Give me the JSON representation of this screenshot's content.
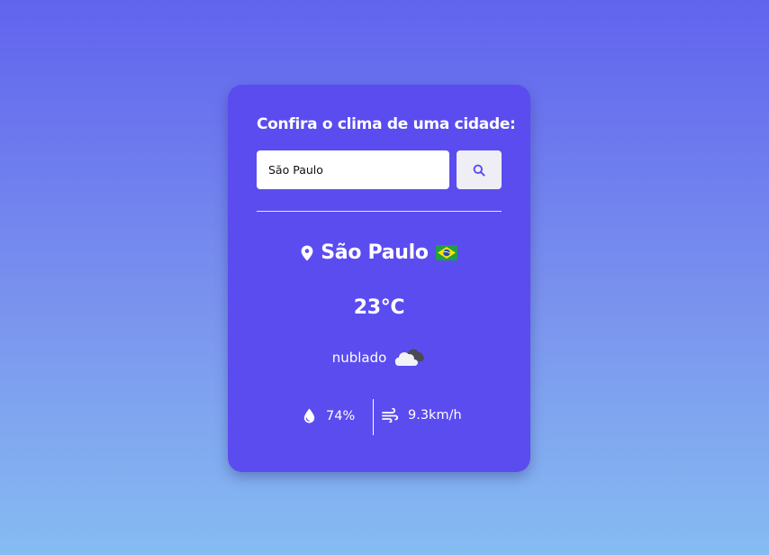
{
  "widget": {
    "heading": "Confira o clima de uma cidade:",
    "search": {
      "value": "São Paulo",
      "placeholder": "",
      "button_icon": "search-icon"
    },
    "location": {
      "icon": "map-pin-icon",
      "city": "São Paulo",
      "flag": "brazil-flag-icon"
    },
    "temperature": "23°C",
    "description": {
      "text": "nublado",
      "icon": "cloudy-weather-icon"
    },
    "humidity": {
      "icon": "droplet-icon",
      "value": "74%"
    },
    "wind": {
      "icon": "wind-icon",
      "value": "9.3km/h"
    }
  },
  "colors": {
    "card_bg": "#5b4cf0",
    "button_bg": "#efeef4",
    "search_icon": "#5b4cf0",
    "text": "#ffffff"
  }
}
